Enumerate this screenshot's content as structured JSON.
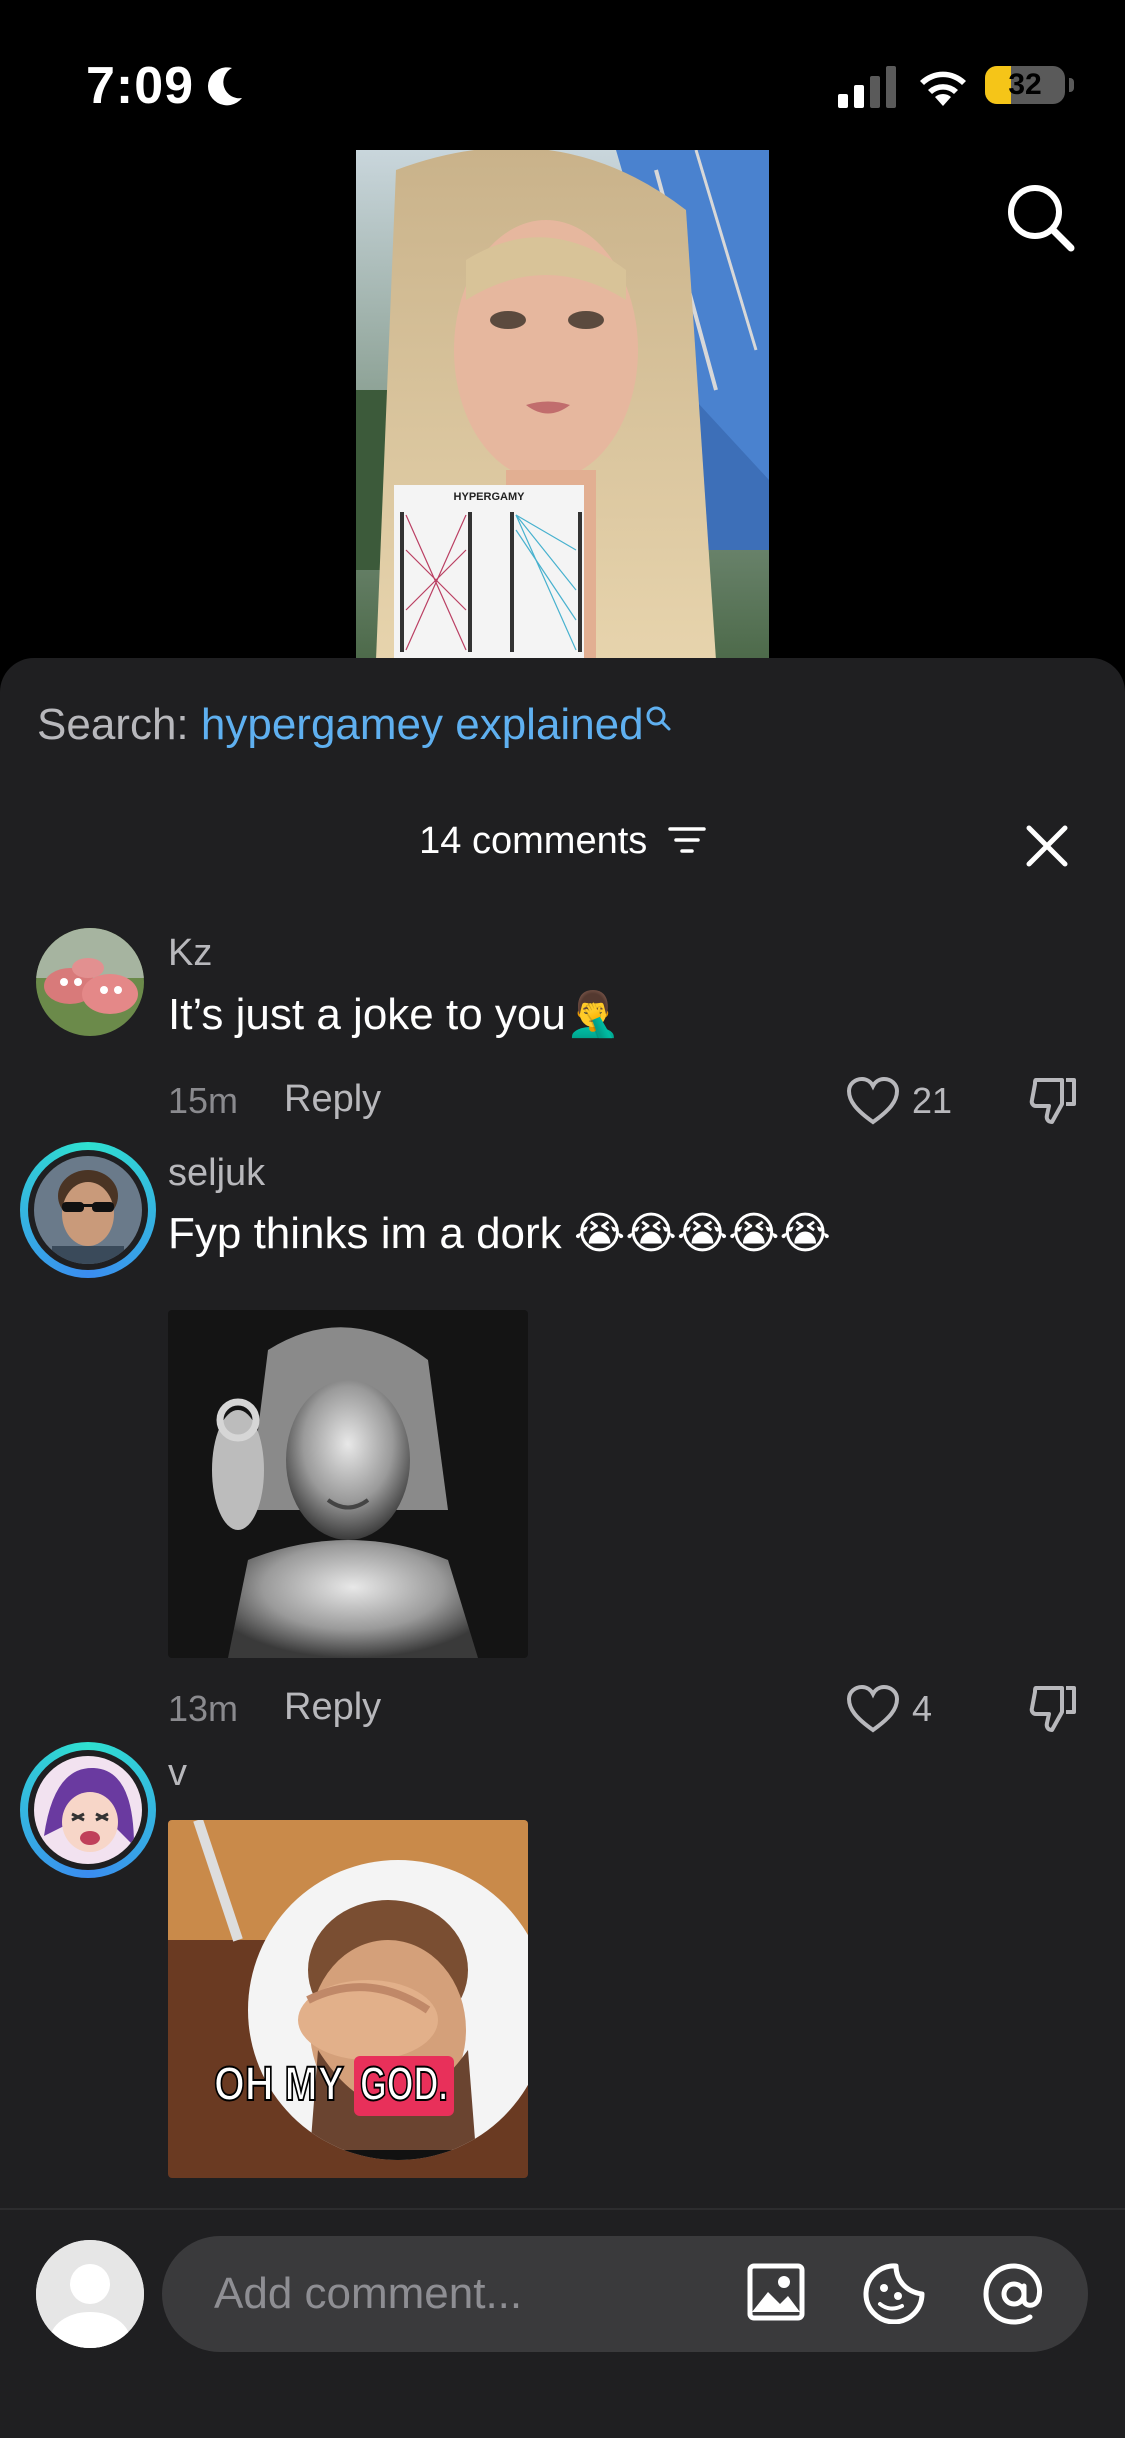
{
  "status_bar": {
    "time": "7:09",
    "battery_percent": "32",
    "battery_level": 0.32
  },
  "colors": {
    "sheet_bg": "#1f1f21",
    "accent_link": "#5fb0f0",
    "battery": "#f5c518"
  },
  "icons": [
    "moon-icon",
    "signal-icon",
    "wifi-icon",
    "search-icon",
    "filter-icon",
    "close-icon",
    "heart-icon",
    "dislike-icon",
    "image-icon",
    "sticker-icon",
    "mention-icon"
  ],
  "video": {
    "overlay_title": "HYPERGAMY"
  },
  "search": {
    "prefix": "Search:",
    "term": "hypergamey explained"
  },
  "comments_header": {
    "count_label": "14 comments"
  },
  "comments": [
    {
      "username": "Kz",
      "text": "It’s just a joke to you🤦‍♂️",
      "time": "15m",
      "reply_label": "Reply",
      "likes": "21"
    },
    {
      "username": "seljuk",
      "text": "Fyp thinks im a dork 😭😭😭😭😭",
      "time": "13m",
      "reply_label": "Reply",
      "likes": "4"
    },
    {
      "username": "v",
      "image_caption_1": "OH MY",
      "image_caption_2": "GOD."
    }
  ],
  "composer": {
    "placeholder": "Add comment..."
  }
}
